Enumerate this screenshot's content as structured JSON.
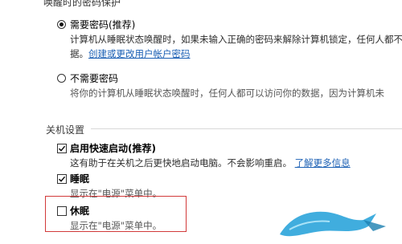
{
  "header": {
    "partial_title": "唤醒时的密码保护"
  },
  "password_section": {
    "option_require": {
      "label": "需要密码(推荐)",
      "checked": true,
      "desc_line1": "计算机从睡眠状态唤醒时，如果未输入正确的密码来解除计算机锁定，任何人都不",
      "desc_line2_prefix": "据。",
      "desc_link": "创建或更改用户帐户密码"
    },
    "option_no_require": {
      "label": "不需要密码",
      "checked": false,
      "desc": "将你的计算机从睡眠状态唤醒时，任何人都可以访问你的数据，因为计算机未"
    }
  },
  "shutdown_section": {
    "title": "关机设置",
    "fast_startup": {
      "label": "启用快速启动(推荐)",
      "checked": true,
      "desc_prefix": "这有助于在关机之后更快地启动电脑。不会影响重启。",
      "desc_link": "了解更多信息"
    },
    "sleep": {
      "label": "睡眠",
      "checked": true,
      "desc": "显示在\"电源\"菜单中。"
    },
    "hibernate": {
      "label": "休眠",
      "checked": false,
      "desc": "显示在\"电源\"菜单中。"
    }
  },
  "colors": {
    "link": "#1a5fb4",
    "highlight": "#d23a3a",
    "watermark": "#1e9fd8"
  }
}
